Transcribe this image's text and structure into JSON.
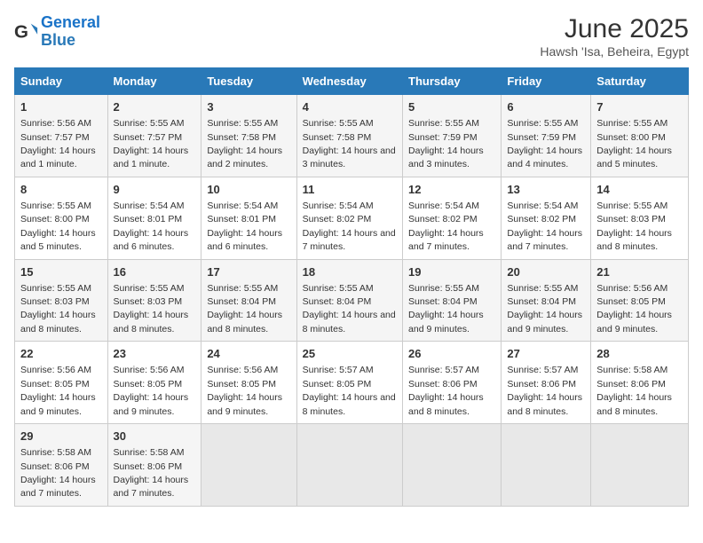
{
  "header": {
    "logo_line1": "General",
    "logo_line2": "Blue",
    "main_title": "June 2025",
    "subtitle": "Hawsh 'Isa, Beheira, Egypt"
  },
  "days_of_week": [
    "Sunday",
    "Monday",
    "Tuesday",
    "Wednesday",
    "Thursday",
    "Friday",
    "Saturday"
  ],
  "weeks": [
    [
      {
        "num": "1",
        "sunrise": "5:56 AM",
        "sunset": "7:57 PM",
        "daylight": "14 hours and 1 minute."
      },
      {
        "num": "2",
        "sunrise": "5:55 AM",
        "sunset": "7:57 PM",
        "daylight": "14 hours and 1 minute."
      },
      {
        "num": "3",
        "sunrise": "5:55 AM",
        "sunset": "7:58 PM",
        "daylight": "14 hours and 2 minutes."
      },
      {
        "num": "4",
        "sunrise": "5:55 AM",
        "sunset": "7:58 PM",
        "daylight": "14 hours and 3 minutes."
      },
      {
        "num": "5",
        "sunrise": "5:55 AM",
        "sunset": "7:59 PM",
        "daylight": "14 hours and 3 minutes."
      },
      {
        "num": "6",
        "sunrise": "5:55 AM",
        "sunset": "7:59 PM",
        "daylight": "14 hours and 4 minutes."
      },
      {
        "num": "7",
        "sunrise": "5:55 AM",
        "sunset": "8:00 PM",
        "daylight": "14 hours and 5 minutes."
      }
    ],
    [
      {
        "num": "8",
        "sunrise": "5:55 AM",
        "sunset": "8:00 PM",
        "daylight": "14 hours and 5 minutes."
      },
      {
        "num": "9",
        "sunrise": "5:54 AM",
        "sunset": "8:01 PM",
        "daylight": "14 hours and 6 minutes."
      },
      {
        "num": "10",
        "sunrise": "5:54 AM",
        "sunset": "8:01 PM",
        "daylight": "14 hours and 6 minutes."
      },
      {
        "num": "11",
        "sunrise": "5:54 AM",
        "sunset": "8:02 PM",
        "daylight": "14 hours and 7 minutes."
      },
      {
        "num": "12",
        "sunrise": "5:54 AM",
        "sunset": "8:02 PM",
        "daylight": "14 hours and 7 minutes."
      },
      {
        "num": "13",
        "sunrise": "5:54 AM",
        "sunset": "8:02 PM",
        "daylight": "14 hours and 7 minutes."
      },
      {
        "num": "14",
        "sunrise": "5:55 AM",
        "sunset": "8:03 PM",
        "daylight": "14 hours and 8 minutes."
      }
    ],
    [
      {
        "num": "15",
        "sunrise": "5:55 AM",
        "sunset": "8:03 PM",
        "daylight": "14 hours and 8 minutes."
      },
      {
        "num": "16",
        "sunrise": "5:55 AM",
        "sunset": "8:03 PM",
        "daylight": "14 hours and 8 minutes."
      },
      {
        "num": "17",
        "sunrise": "5:55 AM",
        "sunset": "8:04 PM",
        "daylight": "14 hours and 8 minutes."
      },
      {
        "num": "18",
        "sunrise": "5:55 AM",
        "sunset": "8:04 PM",
        "daylight": "14 hours and 8 minutes."
      },
      {
        "num": "19",
        "sunrise": "5:55 AM",
        "sunset": "8:04 PM",
        "daylight": "14 hours and 9 minutes."
      },
      {
        "num": "20",
        "sunrise": "5:55 AM",
        "sunset": "8:04 PM",
        "daylight": "14 hours and 9 minutes."
      },
      {
        "num": "21",
        "sunrise": "5:56 AM",
        "sunset": "8:05 PM",
        "daylight": "14 hours and 9 minutes."
      }
    ],
    [
      {
        "num": "22",
        "sunrise": "5:56 AM",
        "sunset": "8:05 PM",
        "daylight": "14 hours and 9 minutes."
      },
      {
        "num": "23",
        "sunrise": "5:56 AM",
        "sunset": "8:05 PM",
        "daylight": "14 hours and 9 minutes."
      },
      {
        "num": "24",
        "sunrise": "5:56 AM",
        "sunset": "8:05 PM",
        "daylight": "14 hours and 9 minutes."
      },
      {
        "num": "25",
        "sunrise": "5:57 AM",
        "sunset": "8:05 PM",
        "daylight": "14 hours and 8 minutes."
      },
      {
        "num": "26",
        "sunrise": "5:57 AM",
        "sunset": "8:06 PM",
        "daylight": "14 hours and 8 minutes."
      },
      {
        "num": "27",
        "sunrise": "5:57 AM",
        "sunset": "8:06 PM",
        "daylight": "14 hours and 8 minutes."
      },
      {
        "num": "28",
        "sunrise": "5:58 AM",
        "sunset": "8:06 PM",
        "daylight": "14 hours and 8 minutes."
      }
    ],
    [
      {
        "num": "29",
        "sunrise": "5:58 AM",
        "sunset": "8:06 PM",
        "daylight": "14 hours and 7 minutes."
      },
      {
        "num": "30",
        "sunrise": "5:58 AM",
        "sunset": "8:06 PM",
        "daylight": "14 hours and 7 minutes."
      },
      null,
      null,
      null,
      null,
      null
    ]
  ]
}
